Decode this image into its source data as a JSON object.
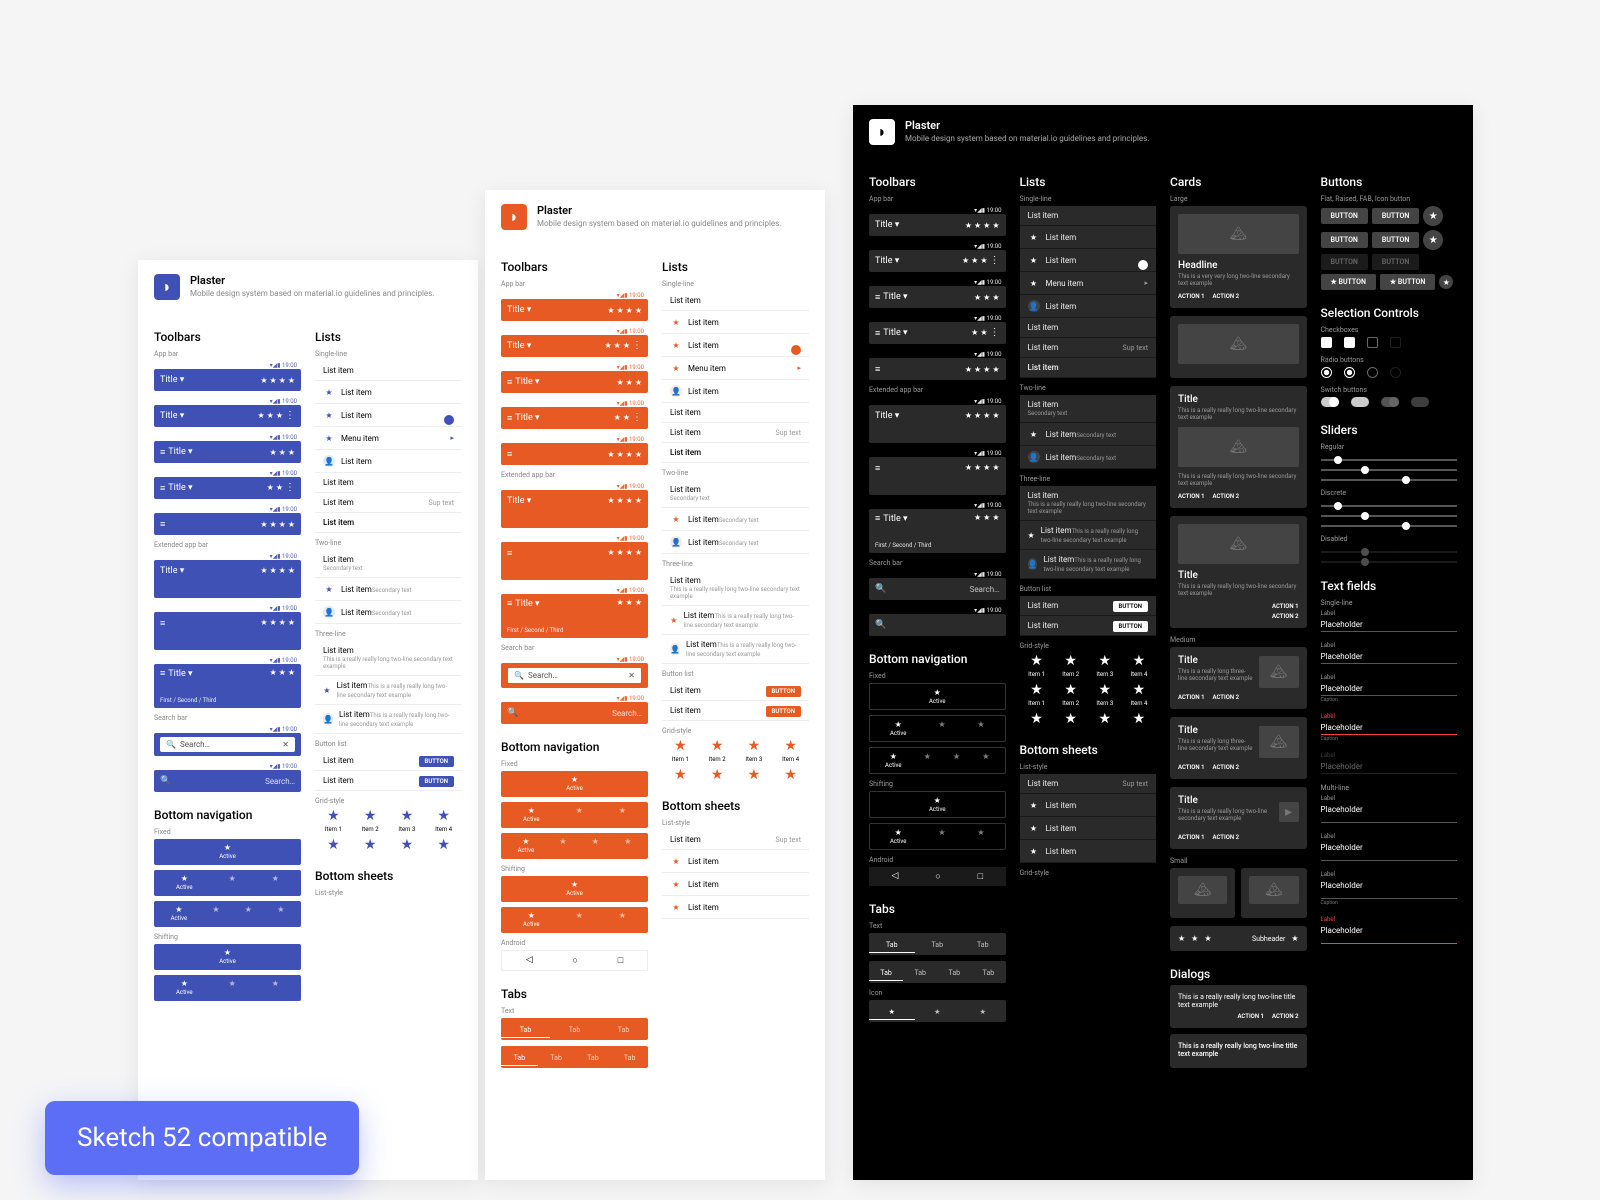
{
  "badge": "Sketch 52 compatible",
  "product": {
    "name": "Plaster",
    "tagline": "Mobile design system based on material.io guidelines and principles."
  },
  "common": {
    "title_label": "Title ▾",
    "time": "19:00",
    "list_item": "List item",
    "menu_item": "Menu item",
    "secondary": "Secondary text",
    "three_line": "This is a really really long two-line secondary text example",
    "sup_text": "Sup text",
    "button_label": "BUTTON",
    "search_ph": "Search…",
    "active": "Active",
    "item_n": "Item",
    "tab": "Tab",
    "action1": "ACTION 1",
    "action2": "ACTION 2",
    "crumbs": "First  /  Second  /  Third"
  },
  "sections": {
    "toolbars": "Toolbars",
    "lists": "Lists",
    "cards": "Cards",
    "buttons": "Buttons",
    "selection": "Selection Controls",
    "sliders": "Sliders",
    "textfields": "Text fields",
    "bottomnav": "Bottom navigation",
    "bottomsheets": "Bottom sheets",
    "tabs": "Tabs",
    "dialogs": "Dialogs"
  },
  "subs": {
    "appbar": "App bar",
    "extended": "Extended app bar",
    "searchbar": "Search bar",
    "singleline": "Single-line",
    "twoline": "Two-line",
    "threeline": "Three-line",
    "buttonlist": "Button list",
    "gridstyle": "Grid-style",
    "fixed": "Fixed",
    "shifting": "Shifting",
    "android": "Android",
    "liststyle": "List-style",
    "text": "Text",
    "icon": "Icon",
    "large": "Large",
    "medium": "Medium",
    "small": "Small",
    "flat_etc": "Flat, Raised, FAB, Icon button",
    "checkboxes": "Checkboxes",
    "radiobuttons": "Radio buttons",
    "switchbuttons": "Switch buttons",
    "regular": "Regular",
    "discrete": "Discrete",
    "disabled": "Disabled",
    "multiline": "Multi-line"
  },
  "cards": {
    "headline": "Headline",
    "title": "Title",
    "sub_long": "This is a very very long two-line secondary text example",
    "sub_med": "This is a really really long two-line secondary text example",
    "sub_short": "This is a really long three-line secondary text example"
  },
  "tf": {
    "label": "Label",
    "placeholder": "Placeholder",
    "caption": "Caption",
    "subheader": "Subheader"
  },
  "dialog": {
    "text": "This is a really really long two-line title text example"
  }
}
